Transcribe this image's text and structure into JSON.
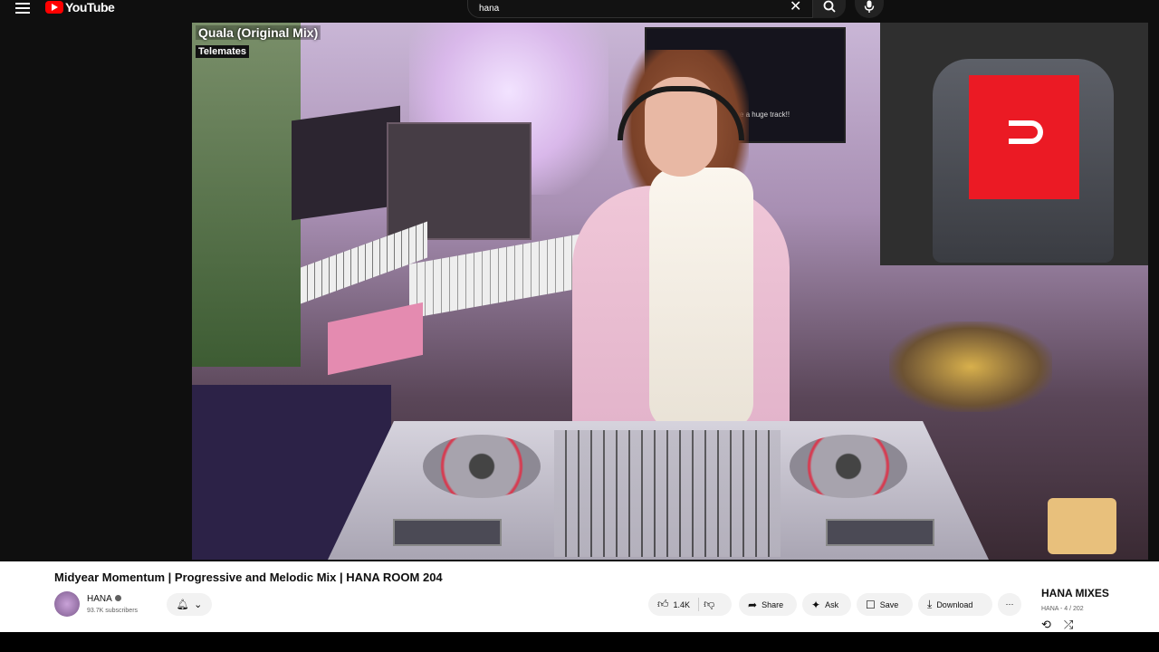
{
  "header": {
    "logo_text": "YouTube",
    "search_value": "hana",
    "clear_icon": "close-icon",
    "search_icon": "search-icon",
    "mic_icon": "mic-icon"
  },
  "player": {
    "song_title": "Quala (Original Mix)",
    "song_artist": "Telemates",
    "tv_text": "have a huge track!!"
  },
  "video": {
    "title": "Midyear Momentum | Progressive and Melodic Mix | HANA ROOM 204",
    "channel_name": "HANA",
    "subscribers": "93.7K subscribers",
    "like_count": "1.4K",
    "share_label": "Share",
    "ask_label": "Ask",
    "save_label": "Save",
    "download_label": "Download",
    "more_label": "⋯"
  },
  "playlist": {
    "title": "HANA MIXES",
    "subtitle": "HANA - 4 / 202"
  },
  "colors": {
    "brand": "#ff0000",
    "background": "#0f0f0f",
    "pill": "#f2f2f2"
  }
}
